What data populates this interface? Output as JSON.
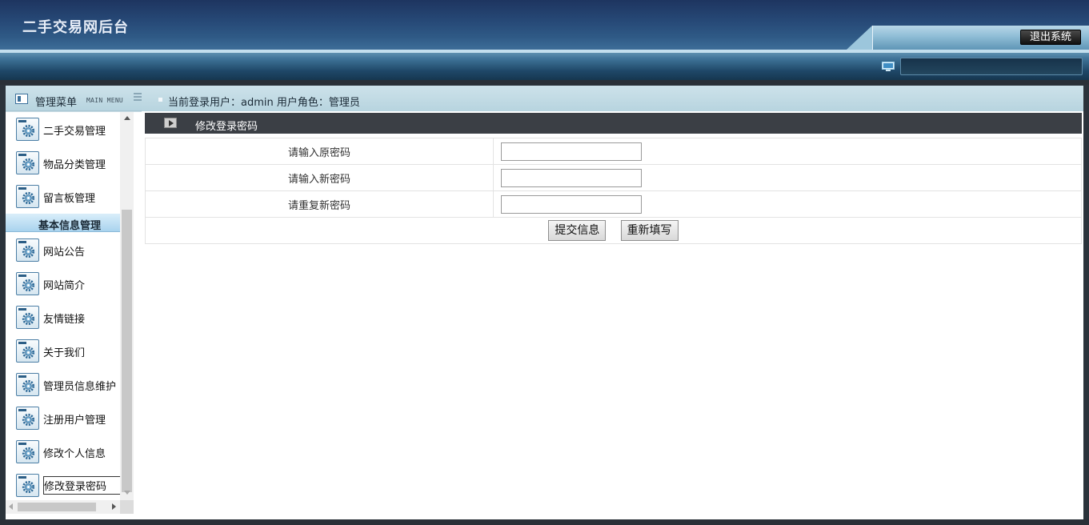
{
  "header": {
    "app_title": "二手交易网后台",
    "logout_label": "退出系统"
  },
  "sidebar": {
    "title": "管理菜单",
    "subtitle": "MAIN MENU",
    "items": [
      {
        "label": "二手交易管理",
        "icon": "gear-icon"
      },
      {
        "label": "物品分类管理",
        "icon": "gear-icon"
      },
      {
        "label": "留言板管理",
        "icon": "gear-icon"
      }
    ],
    "group": {
      "label": "基本信息管理",
      "items": [
        {
          "label": "网站公告",
          "icon": "gear-icon"
        },
        {
          "label": "网站简介",
          "icon": "gear-icon"
        },
        {
          "label": "友情链接",
          "icon": "gear-icon"
        },
        {
          "label": "关于我们",
          "icon": "gear-icon"
        },
        {
          "label": "管理员信息维护",
          "icon": "gear-icon"
        },
        {
          "label": "注册用户管理",
          "icon": "gear-icon"
        },
        {
          "label": "修改个人信息",
          "icon": "gear-icon"
        },
        {
          "label": "修改登录密码",
          "icon": "gear-icon",
          "active": true
        }
      ]
    }
  },
  "main": {
    "user_info": "当前登录用户：admin  用户角色：管理员",
    "section_title": "修改登录密码",
    "form": {
      "old_password_label": "请输入原密码",
      "new_password_label": "请输入新密码",
      "repeat_password_label": "请重复新密码",
      "old_password_value": "",
      "new_password_value": "",
      "repeat_password_value": "",
      "submit_label": "提交信息",
      "reset_label": "重新填写"
    }
  },
  "colors": {
    "header_top": "#1e3560",
    "section_bar": "#3b3f45",
    "menu_group_bg": "#a9d3ee"
  }
}
